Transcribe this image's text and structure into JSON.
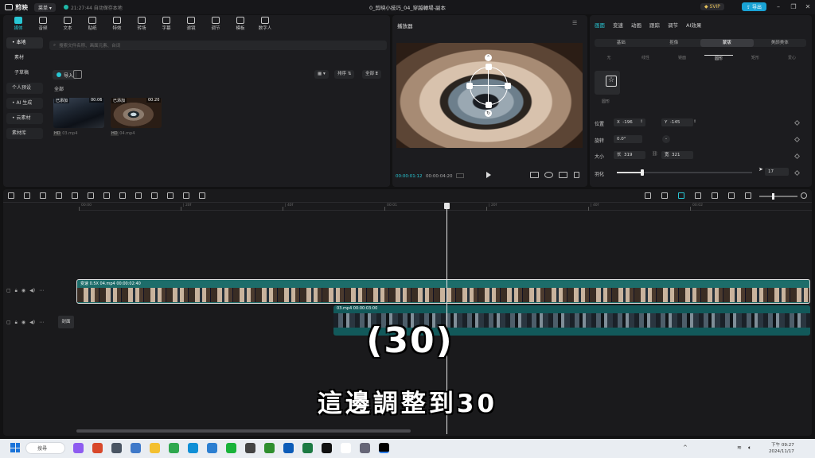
{
  "titlebar": {
    "app_name": "剪映",
    "menu_label": "菜单",
    "save_status": "21:27:44 自动保存本地",
    "doc_title": "0_剪映小技巧_04_穿越轉場-副本",
    "vip_label": "SVIP",
    "publish_label": "导出"
  },
  "media": {
    "tools": [
      {
        "label": "媒体",
        "icon": "media-icon"
      },
      {
        "label": "音频",
        "icon": "audio-icon"
      },
      {
        "label": "文本",
        "icon": "text-icon"
      },
      {
        "label": "贴纸",
        "icon": "sticker-icon"
      },
      {
        "label": "特效",
        "icon": "effects-icon"
      },
      {
        "label": "转场",
        "icon": "transition-icon"
      },
      {
        "label": "字幕",
        "icon": "caption-icon"
      },
      {
        "label": "滤镜",
        "icon": "filter-icon"
      },
      {
        "label": "调节",
        "icon": "adjust-icon"
      },
      {
        "label": "模板",
        "icon": "template-icon"
      },
      {
        "label": "数字人",
        "icon": "avatar-icon"
      }
    ],
    "sidebar": [
      "• 本地",
      "素材",
      "子草稿",
      "个人预设",
      "• AI 生成",
      "• 云素材",
      "素材库"
    ],
    "search_placeholder": "搜索文件名称、画面元素、台词",
    "import_label": "导入",
    "sort_label": "排序",
    "filter_label": "全部",
    "all_label": "全部",
    "clips": [
      {
        "tag": "已添加",
        "duration": "00:06",
        "name": "03.mp4"
      },
      {
        "tag": "已添加",
        "duration": "00:20",
        "name": "04.mp4"
      }
    ]
  },
  "player": {
    "title": "播放器",
    "current_time": "00:00:01:12",
    "total_time": "00:00:04:20"
  },
  "properties": {
    "tabs": [
      "画面",
      "变速",
      "动画",
      "跟踪",
      "调节",
      "AI效果"
    ],
    "subtabs": [
      "基础",
      "抠像",
      "蒙版",
      "美颜美体"
    ],
    "shape_names": [
      "无",
      "线性",
      "镜面",
      "圆形",
      "矩形",
      "爱心"
    ],
    "selected_shape": "圆形",
    "position_label": "位置",
    "x_label": "X",
    "x_value": "-196",
    "y_label": "Y",
    "y_value": "-145",
    "rotate_label": "旋转",
    "rotate_value": "0.0°",
    "size_label": "大小",
    "w_label": "长",
    "w_value": "319",
    "h_label": "宽",
    "h_value": "321",
    "feather_label": "羽化",
    "feather_value": "17"
  },
  "timeline": {
    "ticks": [
      "00:00",
      "| 20f",
      "| 40f",
      "00:01",
      "| 20f",
      "| 40f",
      "00:02"
    ],
    "main_clip_label": "变速 0.5X  04.mp4  00:00:02:40",
    "sub_clip_label": "03.mp4  00:00:03:00",
    "cover_label": "封面"
  },
  "subtitles": {
    "number": "(30)",
    "text": "這邊調整到30"
  },
  "taskbar": {
    "search_label": "搜尋",
    "time": "下午 09:27",
    "date": "2024/11/17"
  },
  "colors": {
    "accent": "#28c7d4",
    "clip": "#1d6d6a",
    "publish": "#19a3d6"
  }
}
